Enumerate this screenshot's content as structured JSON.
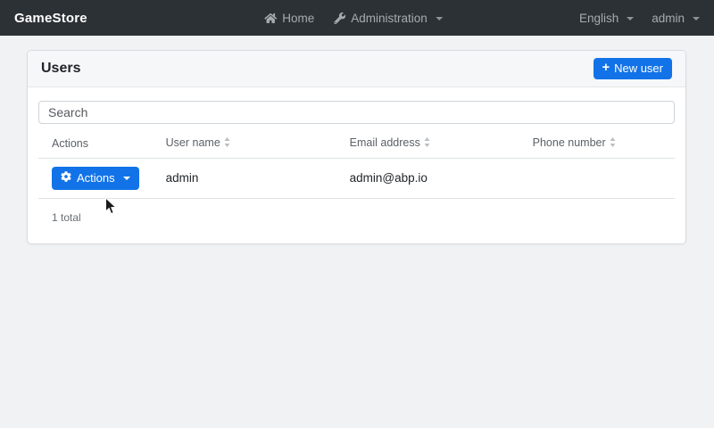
{
  "navbar": {
    "brand": "GameStore",
    "items": [
      {
        "label": "Home",
        "icon": "home-icon"
      },
      {
        "label": "Administration",
        "icon": "wrench-icon"
      }
    ],
    "right_items": [
      {
        "label": "English"
      },
      {
        "label": "admin"
      }
    ]
  },
  "page": {
    "title": "Users",
    "new_user_button": "New user",
    "new_user_plus": "+"
  },
  "search": {
    "placeholder": "Search"
  },
  "table": {
    "columns": [
      {
        "label": "Actions",
        "sortable": false
      },
      {
        "label": "User name",
        "sortable": true
      },
      {
        "label": "Email address",
        "sortable": true
      },
      {
        "label": "Phone number",
        "sortable": true
      }
    ],
    "rows": [
      {
        "actions_button": "Actions",
        "user_name": "admin",
        "email": "admin@abp.io",
        "phone": ""
      }
    ],
    "footer_total": "1 total"
  },
  "colors": {
    "primary": "#1273e8",
    "navbar_bg": "#2c3136",
    "page_bg": "#f0f2f4"
  }
}
